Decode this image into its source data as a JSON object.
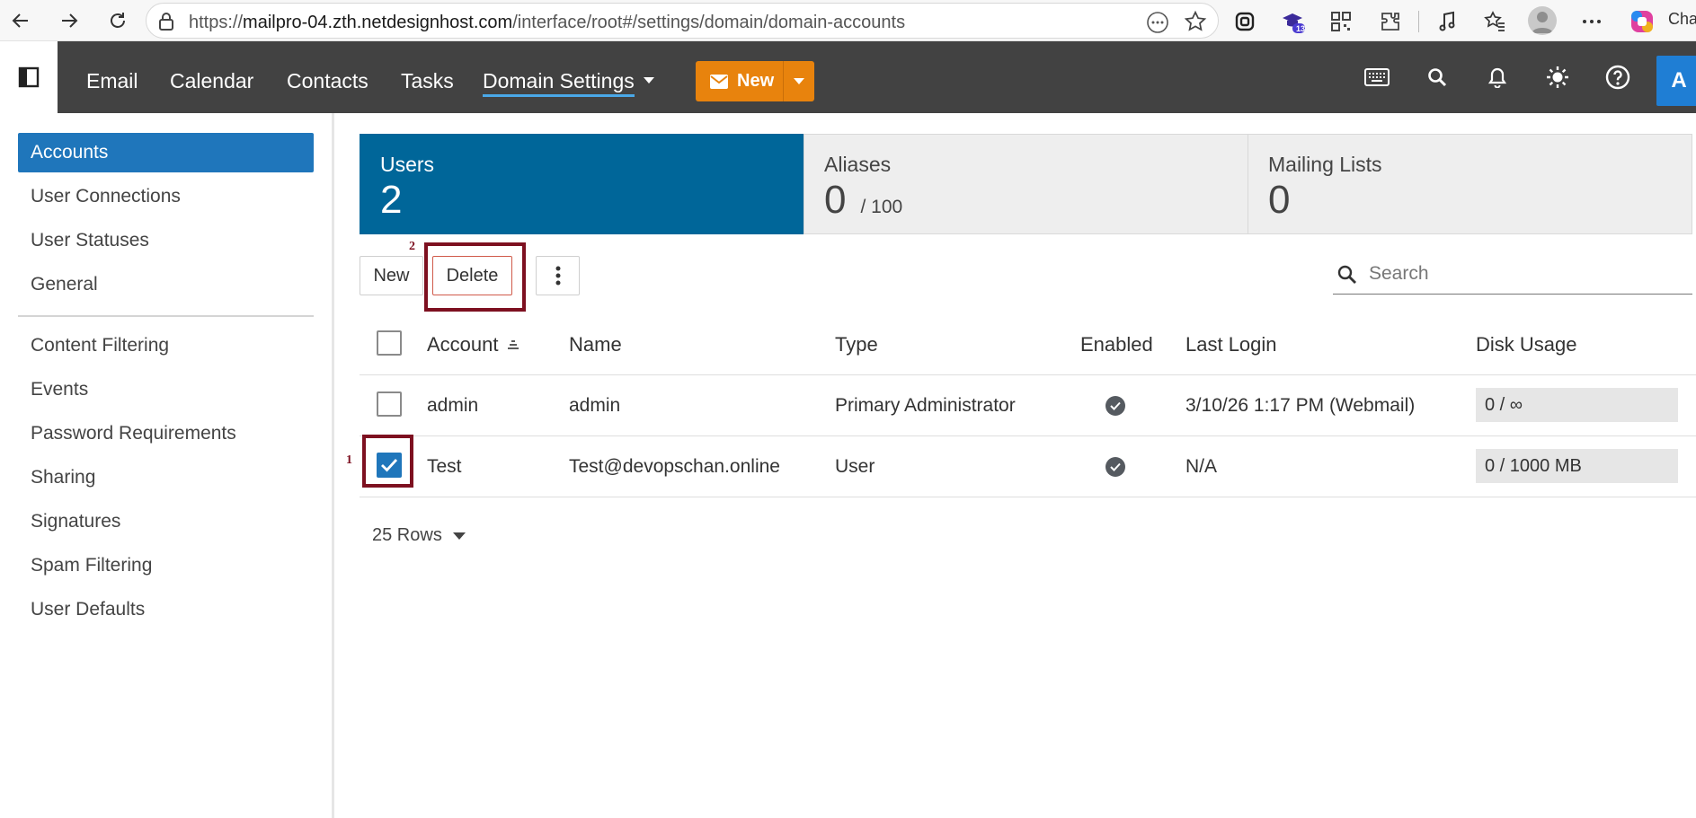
{
  "browser": {
    "url_prefix": "https://",
    "url_host": "mailpro-04.zth.netdesignhost.com",
    "url_path": "/interface/root#/settings/domain/domain-accounts",
    "badge_count": "13",
    "copilot_label": "Cha"
  },
  "nav": {
    "items": [
      "Email",
      "Calendar",
      "Contacts",
      "Tasks"
    ],
    "active_item": "Domain Settings",
    "new_label": "New",
    "user_initial": "A"
  },
  "sidebar": {
    "group1": [
      "Accounts",
      "User Connections",
      "User Statuses",
      "General"
    ],
    "group2": [
      "Content Filtering",
      "Events",
      "Password Requirements",
      "Sharing",
      "Signatures",
      "Spam Filtering",
      "User Defaults"
    ]
  },
  "cards": [
    {
      "label": "Users",
      "value": "2",
      "sub": ""
    },
    {
      "label": "Aliases",
      "value": "0",
      "sub": "/ 100"
    },
    {
      "label": "Mailing Lists",
      "value": "0",
      "sub": ""
    }
  ],
  "toolbar": {
    "new_label": "New",
    "delete_label": "Delete",
    "search_placeholder": "Search",
    "marker_1": "1",
    "marker_2": "2"
  },
  "table": {
    "headers": [
      "Account",
      "Name",
      "Type",
      "Enabled",
      "Last Login",
      "Disk Usage"
    ],
    "rows": [
      {
        "account": "admin",
        "name": "admin",
        "type": "Primary Administrator",
        "enabled": true,
        "last_login": "3/10/26 1:17 PM (Webmail)",
        "disk": "0 / ∞",
        "checked": false
      },
      {
        "account": "Test",
        "name": "Test@devopschan.online",
        "type": "User",
        "enabled": true,
        "last_login": "N/A",
        "disk": "0 / 1000 MB",
        "checked": true
      }
    ]
  },
  "pager": {
    "rows_label": "25 Rows"
  },
  "colors": {
    "accent": "#1f76bb",
    "card_active": "#006699",
    "new_button": "#e8830d",
    "nav_bg": "#424242",
    "highlight": "#7d1020"
  }
}
